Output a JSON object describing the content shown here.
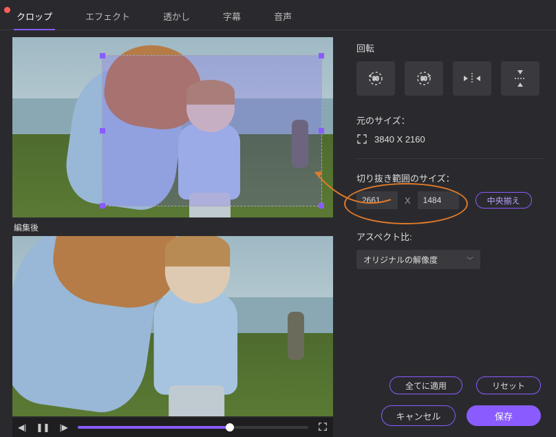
{
  "tabs": {
    "crop": "クロップ",
    "effect": "エフェクト",
    "watermark": "透かし",
    "subtitle": "字幕",
    "audio": "音声"
  },
  "left": {
    "after_label": "編集後"
  },
  "right": {
    "rotate_label": "回転",
    "original_size_label": "元のサイズ：",
    "original_size_value": "3840 X 2160",
    "crop_size_label": "切り抜き範囲のサイズ：",
    "crop_w": "2661",
    "crop_x": "X",
    "crop_h": "1484",
    "center_btn": "中央揃え",
    "aspect_label": "アスペクト比:",
    "aspect_value": "オリジナルの解像度"
  },
  "buttons": {
    "apply_all": "全てに適用",
    "reset": "リセット",
    "cancel": "キャンセル",
    "save": "保存"
  }
}
